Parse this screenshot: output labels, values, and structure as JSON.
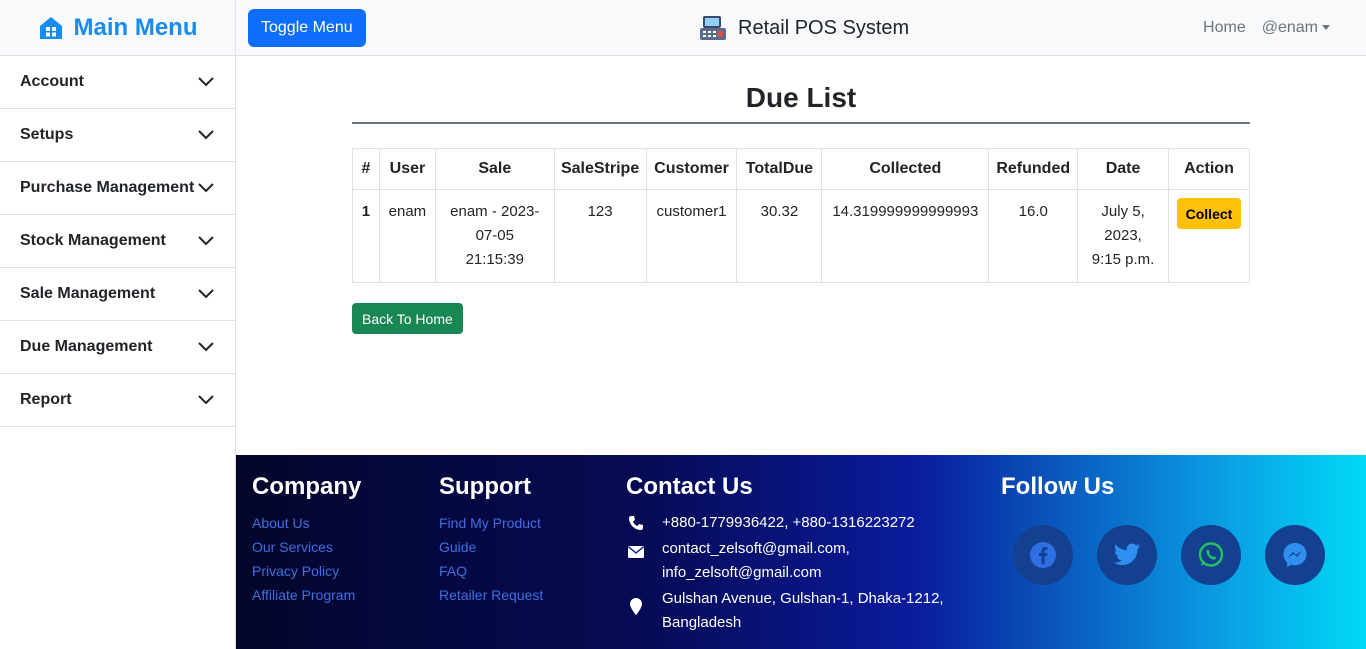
{
  "sidebar": {
    "brand": "Main Menu",
    "items": [
      {
        "label": "Account"
      },
      {
        "label": "Setups"
      },
      {
        "label": "Purchase Management"
      },
      {
        "label": "Stock Management"
      },
      {
        "label": "Sale Management"
      },
      {
        "label": "Due Management"
      },
      {
        "label": "Report"
      }
    ]
  },
  "topbar": {
    "toggle_label": "Toggle Menu",
    "app_title": "Retail POS System",
    "home_label": "Home",
    "user_label": "@enam"
  },
  "page": {
    "title": "Due List",
    "back_label": "Back To Home"
  },
  "table": {
    "headers": [
      "#",
      "User",
      "Sale",
      "SaleStripe",
      "Customer",
      "TotalDue",
      "Collected",
      "Refunded",
      "Date",
      "Action"
    ],
    "rows": [
      {
        "num": "1",
        "user": "enam",
        "sale": "enam - 2023-07-05 21:15:39",
        "salestripe": "123",
        "customer": "customer1",
        "totaldue": "30.32",
        "collected": "14.319999999999993",
        "refunded": "16.0",
        "date": "July 5, 2023, 9:15 p.m.",
        "action": "Collect"
      }
    ]
  },
  "footer": {
    "company": {
      "heading": "Company",
      "links": [
        "About Us",
        "Our Services",
        "Privacy Policy",
        "Affiliate Program"
      ]
    },
    "support": {
      "heading": "Support",
      "links": [
        "Find My Product",
        "Guide",
        "FAQ",
        "Retailer Request"
      ]
    },
    "contact": {
      "heading": "Contact Us",
      "phone": "+880-1779936422, +880-1316223272",
      "email": "contact_zelsoft@gmail.com, info_zelsoft@gmail.com",
      "address": "Gulshan Avenue, Gulshan-1, Dhaka-1212, Bangladesh"
    },
    "follow": {
      "heading": "Follow Us",
      "icons": [
        "facebook-icon",
        "twitter-icon",
        "whatsapp-icon",
        "messenger-icon"
      ]
    }
  },
  "colors": {
    "primary": "#0d6efd",
    "success": "#198754",
    "warning": "#ffc107",
    "brand": "#1a8cf0"
  }
}
